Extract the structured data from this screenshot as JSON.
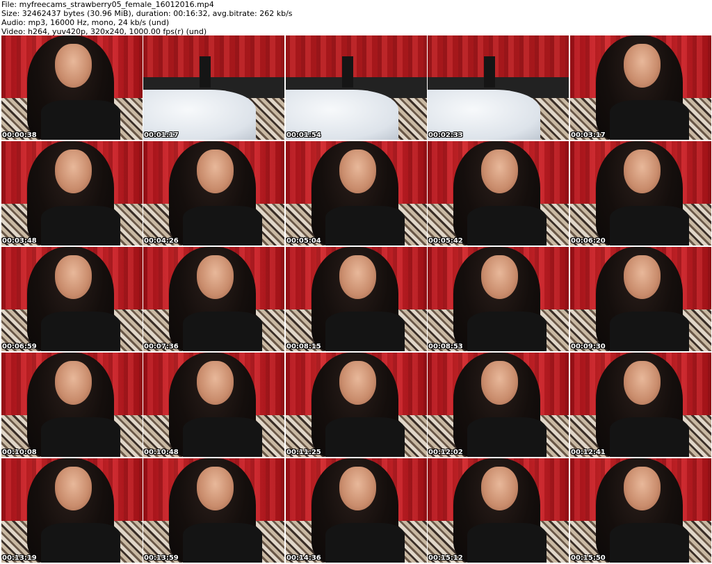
{
  "header": {
    "file": "File: myfreecams_strawberry05_female_16012016.mp4",
    "size": "Size: 32462437 bytes (30.96 MiB), duration: 00:16:32, avg.bitrate: 262 kb/s",
    "audio": "Audio: mp3, 16000 Hz, mono, 24 kb/s (und)",
    "video": "Video: h264, yuv420p, 320x240, 1000.00 fps(r) (und)"
  },
  "thumbnails": [
    {
      "timestamp": "00:00:38",
      "kind": "person"
    },
    {
      "timestamp": "00:01:17",
      "kind": "pillow"
    },
    {
      "timestamp": "00:01:54",
      "kind": "pillow"
    },
    {
      "timestamp": "00:02:33",
      "kind": "pillow"
    },
    {
      "timestamp": "00:03:17",
      "kind": "person"
    },
    {
      "timestamp": "00:03:48",
      "kind": "person"
    },
    {
      "timestamp": "00:04:26",
      "kind": "person"
    },
    {
      "timestamp": "00:05:04",
      "kind": "person"
    },
    {
      "timestamp": "00:05:42",
      "kind": "person"
    },
    {
      "timestamp": "00:06:20",
      "kind": "person"
    },
    {
      "timestamp": "00:06:59",
      "kind": "person"
    },
    {
      "timestamp": "00:07:36",
      "kind": "person"
    },
    {
      "timestamp": "00:08:15",
      "kind": "person"
    },
    {
      "timestamp": "00:08:53",
      "kind": "person"
    },
    {
      "timestamp": "00:09:30",
      "kind": "person"
    },
    {
      "timestamp": "00:10:08",
      "kind": "person"
    },
    {
      "timestamp": "00:10:48",
      "kind": "person"
    },
    {
      "timestamp": "00:11:25",
      "kind": "person"
    },
    {
      "timestamp": "00:12:02",
      "kind": "person"
    },
    {
      "timestamp": "00:12:41",
      "kind": "person"
    },
    {
      "timestamp": "00:13:19",
      "kind": "person"
    },
    {
      "timestamp": "00:13:59",
      "kind": "person"
    },
    {
      "timestamp": "00:14:36",
      "kind": "person"
    },
    {
      "timestamp": "00:15:12",
      "kind": "person"
    },
    {
      "timestamp": "00:15:50",
      "kind": "person"
    }
  ]
}
